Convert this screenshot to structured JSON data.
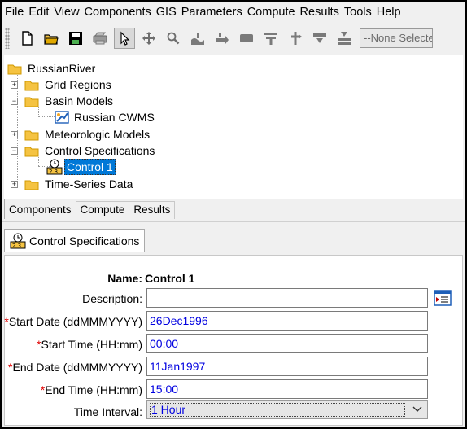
{
  "menubar": {
    "items": [
      "File",
      "Edit",
      "View",
      "Components",
      "GIS",
      "Parameters",
      "Compute",
      "Results",
      "Tools",
      "Help"
    ]
  },
  "toolbar": {
    "icons": [
      "new-file-icon",
      "open-folder-icon",
      "save-disk-icon",
      "print-icon",
      "pointer-arrow-icon",
      "move-arrows-icon",
      "zoom-magnifier-icon",
      "subbasin-tool-icon",
      "reach-tool-icon",
      "reservoir-tool-icon",
      "junction-tool-icon",
      "diversion-tool-icon",
      "source-tool-icon",
      "sink-tool-icon"
    ],
    "basin_select": "--None Selected--"
  },
  "tree": {
    "root": "RussianRiver",
    "nodes": [
      {
        "label": "Grid Regions",
        "expander": "+"
      },
      {
        "label": "Basin Models",
        "expander": "−"
      },
      {
        "label": "Russian CWMS",
        "icon": "basin-model-icon"
      },
      {
        "label": "Meteorologic Models",
        "expander": "+"
      },
      {
        "label": "Control Specifications",
        "expander": "−"
      },
      {
        "label": "Control 1",
        "icon": "control-spec-icon",
        "selected": true
      },
      {
        "label": "Time-Series Data",
        "expander": "+"
      }
    ]
  },
  "bottom_tabs": [
    "Components",
    "Compute",
    "Results"
  ],
  "editor": {
    "tab_label": "Control Specifications",
    "name_label": "Name:",
    "name_value": "Control 1",
    "description_label": "Description:",
    "description_value": "",
    "start_date_label": "Start Date (ddMMMYYYY)",
    "start_date_value": "26Dec1996",
    "start_time_label": "Start Time (HH:mm)",
    "start_time_value": "00:00",
    "end_date_label": "End Date (ddMMMYYYY)",
    "end_date_value": "11Jan1997",
    "end_time_label": "End Time (HH:mm)",
    "end_time_value": "15:00",
    "time_interval_label": "Time Interval:",
    "time_interval_value": "1 Hour",
    "required_marker": "*"
  },
  "colors": {
    "selection": "#0078d7",
    "value_text": "#0000e0",
    "required": "#e00000",
    "folder": "#f5c342"
  }
}
